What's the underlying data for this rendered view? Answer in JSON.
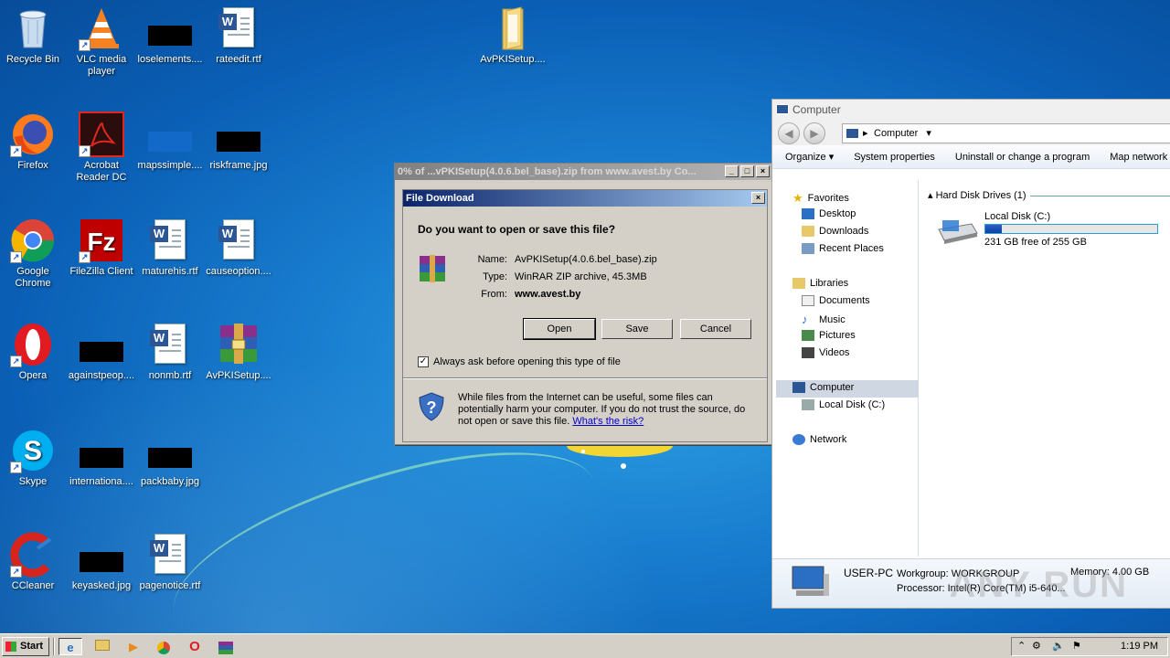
{
  "desktop": {
    "icons": [
      {
        "label": "Recycle Bin",
        "icon": "recycle-bin-icon"
      },
      {
        "label": "VLC media player",
        "icon": "vlc-icon"
      },
      {
        "label": "loselements....",
        "icon": "image-thumbnail-icon"
      },
      {
        "label": "rateedit.rtf",
        "icon": "word-document-icon"
      },
      {
        "label": "AvPKISetup....",
        "icon": "folder-icon"
      },
      {
        "label": "Firefox",
        "icon": "firefox-icon"
      },
      {
        "label": "Acrobat Reader DC",
        "icon": "acrobat-icon"
      },
      {
        "label": "mapssimple....",
        "icon": "image-thumbnail-icon"
      },
      {
        "label": "riskframe.jpg",
        "icon": "image-thumbnail-icon"
      },
      {
        "label": "Google Chrome",
        "icon": "chrome-icon"
      },
      {
        "label": "FileZilla Client",
        "icon": "filezilla-icon"
      },
      {
        "label": "maturehis.rtf",
        "icon": "word-document-icon"
      },
      {
        "label": "causeoption....",
        "icon": "word-document-icon"
      },
      {
        "label": "Opera",
        "icon": "opera-icon"
      },
      {
        "label": "againstpeop....",
        "icon": "image-thumbnail-icon"
      },
      {
        "label": "nonmb.rtf",
        "icon": "word-document-icon"
      },
      {
        "label": "AvPKISetup....",
        "icon": "winrar-icon"
      },
      {
        "label": "Skype",
        "icon": "skype-icon"
      },
      {
        "label": "internationa....",
        "icon": "image-thumbnail-icon"
      },
      {
        "label": "packbaby.jpg",
        "icon": "image-thumbnail-icon"
      },
      {
        "label": "CCleaner",
        "icon": "ccleaner-icon"
      },
      {
        "label": "keyasked.jpg",
        "icon": "image-thumbnail-icon"
      },
      {
        "label": "pagenotice.rtf",
        "icon": "word-document-icon"
      }
    ]
  },
  "download_window": {
    "title": "0% of ...vPKISetup(4.0.6.bel_base).zip from www.avest.by Co...",
    "dialog_title": "File Download",
    "question": "Do you want to open or save this file?",
    "name_label": "Name:",
    "name_value": "AvPKISetup(4.0.6.bel_base).zip",
    "type_label": "Type:",
    "type_value": "WinRAR ZIP archive, 45.3MB",
    "from_label": "From:",
    "from_value": "www.avest.by",
    "open_label": "Open",
    "save_label": "Save",
    "cancel_label": "Cancel",
    "checkbox_label": "Always ask before opening this type of file",
    "checkbox_checked": true,
    "warning_text": "While files from the Internet can be useful, some files can potentially harm your computer. If you do not trust the source, do not open or save this file.",
    "warning_link": "What's the risk?"
  },
  "explorer": {
    "title": "Computer",
    "address": "Computer",
    "commands": [
      "Organize",
      "System properties",
      "Uninstall or change a program",
      "Map network dri"
    ],
    "nav": {
      "favorites": "Favorites",
      "desktop": "Desktop",
      "downloads": "Downloads",
      "recent": "Recent Places",
      "libraries": "Libraries",
      "documents": "Documents",
      "music": "Music",
      "pictures": "Pictures",
      "videos": "Videos",
      "computer": "Computer",
      "local_disk": "Local Disk (C:)",
      "network": "Network"
    },
    "group_header": "Hard Disk Drives (1)",
    "drive": {
      "name": "Local Disk (C:)",
      "free": "231 GB free of 255 GB",
      "used_fraction": 0.094
    },
    "details": {
      "computer_name": "USER-PC",
      "workgroup": "Workgroup: WORKGROUP",
      "memory": "Memory: 4.00 GB",
      "processor": "Processor: Intel(R) Core(TM) i5-640..."
    },
    "watermark": "ANY RUN"
  },
  "taskbar": {
    "start_label": "Start",
    "time": "1:19 PM"
  },
  "colors": {
    "accent": "#0a246a",
    "desktop_blue": "#1a7fd0"
  }
}
